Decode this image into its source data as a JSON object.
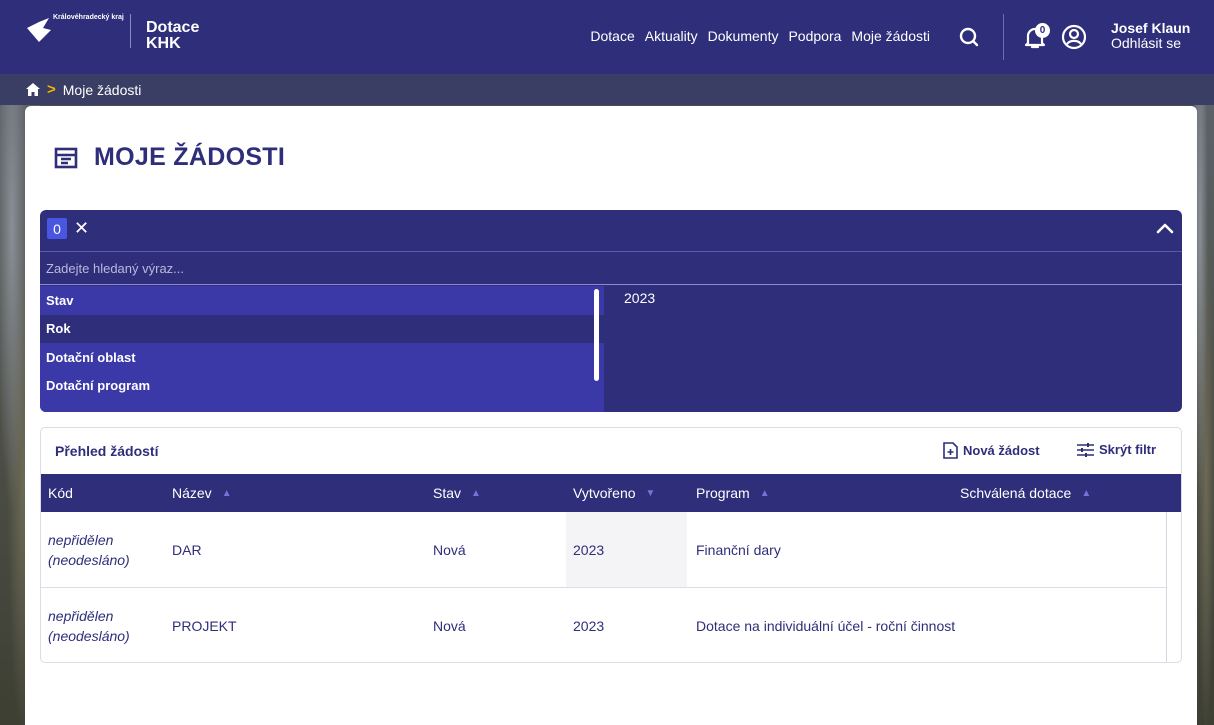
{
  "header": {
    "logo_text": "Královéhradecký kraj",
    "app_title_line1": "Dotace",
    "app_title_line2": "KHK",
    "nav": [
      "Dotace",
      "Aktuality",
      "Dokumenty",
      "Podpora",
      "Moje žádosti"
    ],
    "notifications_count": "0",
    "user_name": "Josef Klaun",
    "logout_label": "Odhlásit se"
  },
  "breadcrumb": {
    "current": "Moje žádosti"
  },
  "page": {
    "title": "MOJE ŽÁDOSTI"
  },
  "filter": {
    "selected_count": "0",
    "search_placeholder": "Zadejte hledaný výraz...",
    "categories": [
      "Stav",
      "Rok",
      "Dotační oblast",
      "Dotační program"
    ],
    "active_category": "Rok",
    "values": [
      "2023"
    ]
  },
  "table": {
    "title": "Přehled žádostí",
    "new_label": "Nová žádost",
    "hide_filter_label": "Skrýt filtr",
    "columns": [
      "Kód",
      "Název",
      "Stav",
      "Vytvořeno",
      "Program",
      "Schválená dotace"
    ],
    "rows": [
      {
        "kod_line1": "nepřidělen",
        "kod_line2": "(neodesláno)",
        "nazev": "DAR",
        "stav": "Nová",
        "vytvoreno": "2023",
        "program": "Finanční dary",
        "schvalena": ""
      },
      {
        "kod_line1": "nepřidělen",
        "kod_line2": "(neodesláno)",
        "nazev": "PROJEKT",
        "stav": "Nová",
        "vytvoreno": "2023",
        "program": "Dotace na individuální účel - roční činnost",
        "schvalena": ""
      }
    ]
  },
  "colors": {
    "primary": "#2e2e7a",
    "accent": "#f4b400",
    "chip": "#4a55e0"
  }
}
